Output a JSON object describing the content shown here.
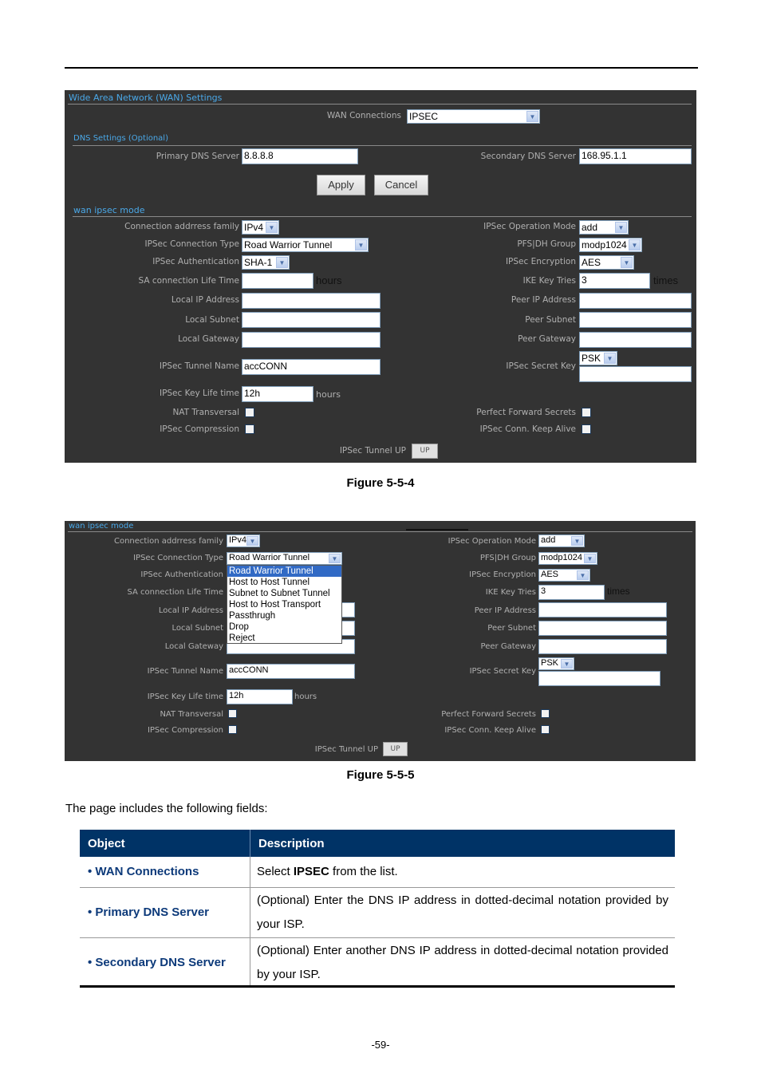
{
  "figure1": {
    "caption": "Figure 5-5-4",
    "wan_title": "Wide Area Network (WAN) Settings",
    "wan_connections_label": "WAN Connections",
    "wan_connections_value": "IPSEC",
    "dns_title": "DNS Settings (Optional)",
    "primary_dns_label": "Primary DNS Server",
    "primary_dns_value": "8.8.8.8",
    "secondary_dns_label": "Secondary DNS Server",
    "secondary_dns_value": "168.95.1.1",
    "apply_label": "Apply",
    "cancel_label": "Cancel",
    "ipsec_title": "wan ipsec mode",
    "left": {
      "addr_family_label": "Connection addrress family",
      "addr_family_value": "IPv4",
      "conn_type_label": "IPSec Connection Type",
      "conn_type_value": "Road Warrior Tunnel",
      "auth_label": "IPSec Authentication",
      "auth_value": "SHA-1",
      "sa_life_label": "SA connection Life Time",
      "sa_life_value": "",
      "sa_life_unit": "hours",
      "local_ip_label": "Local IP Address",
      "local_ip_value": "",
      "local_subnet_label": "Local Subnet",
      "local_subnet_value": "",
      "local_gateway_label": "Local Gateway",
      "local_gateway_value": "",
      "tunnel_name_label": "IPSec Tunnel Name",
      "tunnel_name_value": "accCONN",
      "key_life_label": "IPSec Key Life time",
      "key_life_value": "12h",
      "key_life_unit": "hours",
      "nat_label": "NAT Transversal",
      "compression_label": "IPSec Compression"
    },
    "right": {
      "op_mode_label": "IPSec Operation Mode",
      "op_mode_value": "add",
      "pfs_label": "PFS|DH Group",
      "pfs_value": "modp1024",
      "enc_label": "IPSec Encryption",
      "enc_value": "AES",
      "ike_label": "IKE Key Tries",
      "ike_value": "3",
      "ike_unit": "times",
      "peer_ip_label": "Peer IP Address",
      "peer_ip_value": "",
      "peer_subnet_label": "Peer Subnet",
      "peer_subnet_value": "",
      "peer_gateway_label": "Peer Gateway",
      "peer_gateway_value": "",
      "secret_label": "IPSec Secret Key",
      "secret_type_value": "PSK",
      "secret_value": "",
      "pfs_check_label": "Perfect Forward Secrets",
      "keepalive_label": "IPSec Conn. Keep Alive"
    },
    "tunnel_up_label": "IPSec Tunnel UP",
    "up_button": "UP"
  },
  "figure2": {
    "caption": "Figure 5-5-5",
    "ipsec_title": "wan ipsec mode",
    "conn_type_options": [
      "Road Warrior Tunnel",
      "Host to Host Tunnel",
      "Subnet to Subnet Tunnel",
      "Host to Host Transport",
      "Passthrugh",
      "Drop",
      "Reject"
    ],
    "conn_type_highlighted": "Road Warrior Tunnel"
  },
  "body_text": "The page includes the following fields:",
  "table": {
    "headers": [
      "Object",
      "Description"
    ],
    "rows": [
      {
        "object": "WAN Connections",
        "desc_pre": "Select ",
        "desc_bold": "IPSEC",
        "desc_post": " from the list."
      },
      {
        "object": "Primary DNS Server",
        "desc_pre": "(Optional) Enter the DNS IP address in dotted-decimal notation provided by your ISP.",
        "desc_bold": "",
        "desc_post": ""
      },
      {
        "object": "Secondary DNS Server",
        "desc_pre": "(Optional) Enter another DNS IP address in dotted-decimal notation provided by your ISP.",
        "desc_bold": "",
        "desc_post": ""
      }
    ]
  },
  "page_number": "-59-"
}
